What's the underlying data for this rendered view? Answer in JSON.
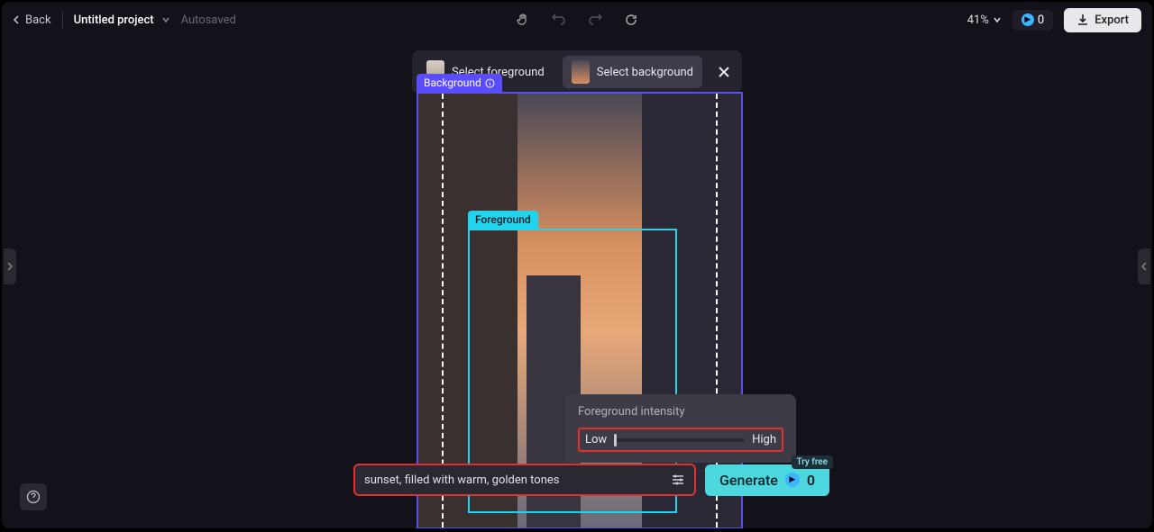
{
  "topbar": {
    "back": "Back",
    "project_name": "Untitled project",
    "autosaved": "Autosaved",
    "zoom": "41%",
    "credits": "0",
    "export": "Export"
  },
  "modes": {
    "foreground": "Select foreground",
    "background": "Select background"
  },
  "canvas": {
    "bg_label": "Background",
    "fg_label": "Foreground"
  },
  "intensity": {
    "title": "Foreground intensity",
    "low": "Low",
    "high": "High"
  },
  "prompt": {
    "text": "sunset, filled with warm, golden tones",
    "generate": "Generate",
    "try_free": "Try free",
    "count": "0"
  }
}
